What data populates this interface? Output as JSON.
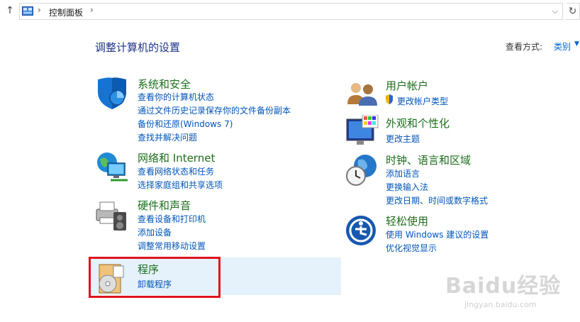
{
  "address": {
    "breadcrumb": "控制面板",
    "separator": "›"
  },
  "title": "调整计算机的设置",
  "view_by": {
    "label": "查看方式:",
    "value": "类别"
  },
  "categories": {
    "security": {
      "heading": "系统和安全",
      "links": [
        "查看你的计算机状态",
        "通过文件历史记录保存你的文件备份副本",
        "备份和还原(Windows 7)",
        "查找并解决问题"
      ]
    },
    "network": {
      "heading": "网络和 Internet",
      "links": [
        "查看网络状态和任务",
        "选择家庭组和共享选项"
      ]
    },
    "hardware": {
      "heading": "硬件和声音",
      "links": [
        "查看设备和打印机",
        "添加设备",
        "调整常用移动设置"
      ]
    },
    "programs": {
      "heading": "程序",
      "links": [
        "卸载程序"
      ]
    },
    "accounts": {
      "heading": "用户帐户",
      "links": [
        "更改帐户类型"
      ]
    },
    "appearance": {
      "heading": "外观和个性化",
      "links": [
        "更改主题"
      ]
    },
    "clock": {
      "heading": "时钟、语言和区域",
      "links": [
        "添加语言",
        "更换输入法",
        "更改日期、时间或数字格式"
      ]
    },
    "ease": {
      "heading": "轻松使用",
      "links": [
        "使用 Windows 建议的设置",
        "优化视觉显示"
      ]
    }
  },
  "watermark": {
    "logo": "Baidu经验",
    "url": "jingyan.baidu.com"
  },
  "colors": {
    "heading": "#1b6e1b",
    "link": "#0055b8",
    "title": "#1e3287",
    "highlight": "#e5f1fb",
    "annotation": "#e0141e"
  }
}
